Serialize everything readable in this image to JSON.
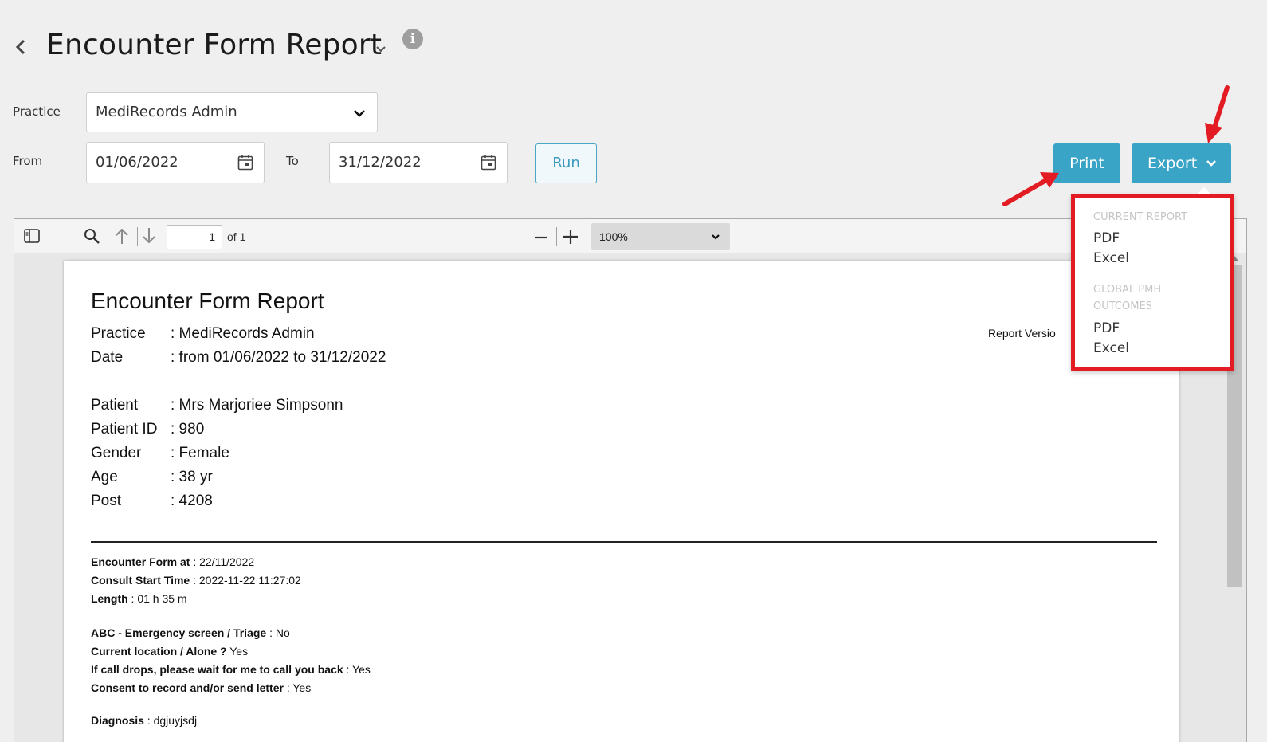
{
  "header": {
    "title": "Encounter Form Report",
    "info_icon": "i"
  },
  "filters": {
    "practice_label": "Practice",
    "practice_value": "MediRecords Admin",
    "from_label": "From",
    "from_value": "01/06/2022",
    "to_label": "To",
    "to_value": "31/12/2022",
    "run_label": "Run"
  },
  "actions": {
    "print_label": "Print",
    "export_label": "Export"
  },
  "export_menu": {
    "section1_header": "CURRENT REPORT",
    "section1_items": [
      "PDF",
      "Excel"
    ],
    "section2_header": "GLOBAL PMH OUTCOMES",
    "section2_items": [
      "PDF",
      "Excel"
    ]
  },
  "viewer": {
    "page_number": "1",
    "page_count": "of 1",
    "zoom": "100%"
  },
  "report": {
    "title": "Encounter Form Report",
    "version_label": "Report Versio",
    "practice_key": "Practice",
    "practice_val": ": MediRecords Admin",
    "date_key": "Date",
    "date_val": ": from 01/06/2022 to 31/12/2022",
    "patient_key": "Patient",
    "patient_val": ": Mrs Marjoriee Simpsonn",
    "pid_key": "Patient ID",
    "pid_val": ": 980",
    "gender_key": "Gender",
    "gender_val": ": Female",
    "age_key": "Age",
    "age_val": ": 38 yr",
    "post_key": "Post",
    "post_val": ": 4208",
    "lines": [
      {
        "key": "Encounter Form at",
        "val": " : 22/11/2022"
      },
      {
        "key": "Consult Start Time",
        "val": " : 2022-11-22 11:27:02"
      },
      {
        "key": "Length",
        "val": " : 01 h 35 m"
      },
      {
        "key": "ABC - Emergency screen / Triage",
        "val": " : No"
      },
      {
        "key": "Current location / Alone ?",
        "val": " Yes"
      },
      {
        "key": "If call drops, please wait for me to call you back",
        "val": " : Yes"
      },
      {
        "key": "Consent to record and/or send letter",
        "val": " : Yes"
      },
      {
        "key": "Diagnosis",
        "val": " : dgjuyjsdj"
      }
    ]
  },
  "colors": {
    "accent": "#3aa4c6",
    "highlight": "#e31b23"
  }
}
